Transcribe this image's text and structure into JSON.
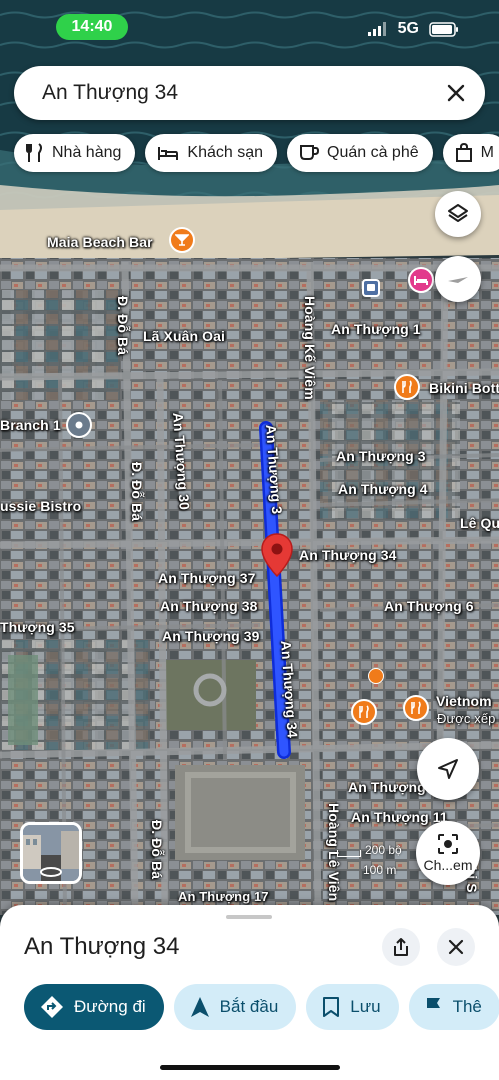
{
  "status": {
    "time": "14:40",
    "network": "5G"
  },
  "search": {
    "query": "An Thượng 34"
  },
  "chips": [
    {
      "label": "Nhà hàng",
      "icon": "fork-knife-icon"
    },
    {
      "label": "Khách sạn",
      "icon": "bed-icon"
    },
    {
      "label": "Quán cà phê",
      "icon": "coffee-icon"
    },
    {
      "label": "M",
      "icon": "shopping-bag-icon"
    }
  ],
  "map": {
    "labels": {
      "maia": "Maia Beach Bar",
      "la_xuan_oai": "Lã Xuân Oai",
      "hoang_ke_viem": "Hoàng Kế Viêm",
      "an_thuong_1": "An Thượng 1",
      "bikini": "Bikini Bott",
      "branch": "Branch 1",
      "d_do_ba_1": "Đ. Đỗ Bá",
      "d_do_ba_2": "Đ. Đỗ Bá",
      "d_do_ba_3": "Đ. Đỗ Bá",
      "an_thuong_30": "An Thượng 30",
      "an_thuong_32": "An Thượng 3",
      "an_thuong_3": "An Thượng 3",
      "an_thuong_4": "An Thượng 4",
      "ussie": "ussie Bistro",
      "le_qu": "Lê Qu",
      "an_thuong_34": "An Thượng 34",
      "an_thuong_37": "An Thượng 37",
      "an_thuong_38": "An Thượng 38",
      "an_thuong_39": "An Thượng 39",
      "an_thuong_6": "An Thượng 6",
      "thuong_35": "Thượng 35",
      "an_thuong_34_road": "An Thượng 34",
      "vietnom": "Vietnom",
      "duoc_xep": "Được xếp h",
      "an_thuong_10": "An Thượng",
      "an_thuong_11": "An Thượng 11",
      "hoang_le_vien": "Hoàng Lê Viên",
      "thi_s": "Thi S",
      "an_thuong_17": "An Thượng 17"
    },
    "scale": {
      "ft": "200 bộ",
      "m": "100 m"
    },
    "camera_button": "Ch...em"
  },
  "place": {
    "title": "An Thượng 34",
    "actions": [
      {
        "label": "Đường đi",
        "icon": "directions-icon"
      },
      {
        "label": "Bắt đầu",
        "icon": "navigation-arrow-icon"
      },
      {
        "label": "Lưu",
        "icon": "bookmark-icon"
      },
      {
        "label": "Thê",
        "icon": "flag-icon"
      }
    ]
  },
  "colors": {
    "accent": "#0b5873",
    "chip_bg": "#d3ecf8",
    "route": "#1a3cff",
    "pin": "#e53935",
    "restaurant_pin": "#f07b1a",
    "hotel_pin": "#e23a8c"
  }
}
